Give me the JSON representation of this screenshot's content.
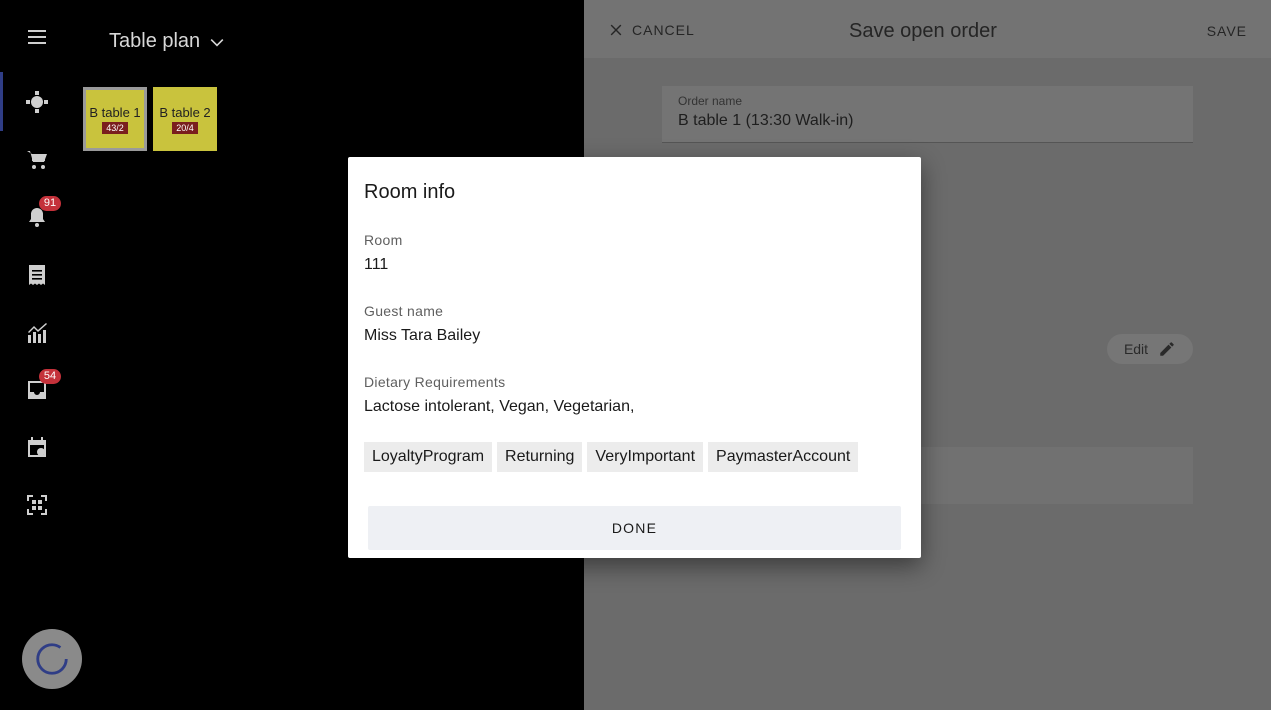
{
  "plan": {
    "title": "Table plan",
    "tables": [
      {
        "name": "B table 1",
        "count": "43/2"
      },
      {
        "name": "B table 2",
        "count": "20/4"
      }
    ]
  },
  "rail": {
    "notification_badge": "91",
    "inbox_badge": "54"
  },
  "drawer": {
    "cancel_label": "CANCEL",
    "title": "Save open order",
    "save_label": "SAVE",
    "order_name_label": "Order name",
    "order_name_value": "B table 1 (13:30 Walk-in)",
    "edit_label": "Edit"
  },
  "modal": {
    "title": "Room info",
    "room_label": "Room",
    "room_value": "111",
    "guest_label": "Guest name",
    "guest_value": "Miss Tara Bailey",
    "dietary_label": "Dietary Requirements",
    "dietary_value": "Lactose intolerant, Vegan, Vegetarian,",
    "tags": [
      "LoyaltyProgram",
      "Returning",
      "VeryImportant",
      "PaymasterAccount"
    ],
    "done_label": "DONE"
  },
  "colors": {
    "accent": "#2f3d86",
    "table_tile": "#c9c33d",
    "badge": "#c4313a"
  }
}
